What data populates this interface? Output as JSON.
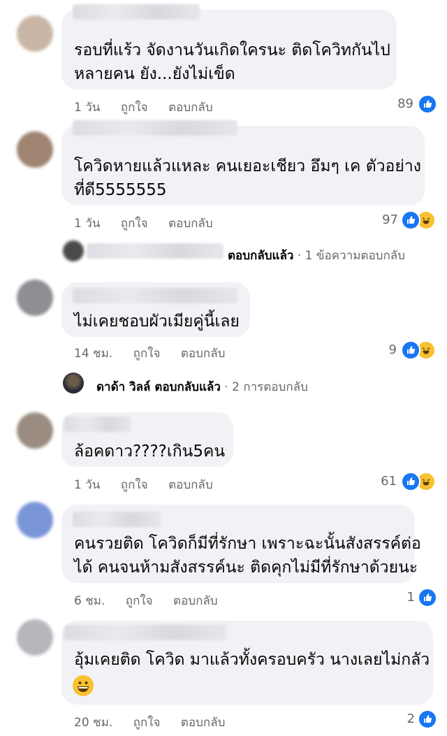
{
  "comments": [
    {
      "text_lines": [
        "รอบที่แร้ว จัดงานวันเกิดใครนะ  ติดโควิทกันไป",
        "หลายคน ยัง...ยังไม่เข็ด"
      ],
      "time": "1 วัน",
      "like": "ถูกใจ",
      "reply": "ตอบกลับ",
      "reaction_count": "89",
      "reactions": [
        "like-icon"
      ]
    },
    {
      "text_lines": [
        "โควิดหายแล้วแหละ คนเยอะเชียว อึมๆ เค ตัวอย่าง",
        "ที่ดี5555555"
      ],
      "time": "1 วัน",
      "like": "ถูกใจ",
      "reply": "ตอบกลับ",
      "reaction_count": "97",
      "reactions": [
        "like-icon",
        "haha-icon"
      ]
    },
    {
      "text_lines": [
        "ไม่เคยชอบผัวเมียคู่นี้เลย"
      ],
      "time": "14 ชม.",
      "like": "ถูกใจ",
      "reply": "ตอบกลับ",
      "reaction_count": "9",
      "reactions": [
        "like-icon",
        "haha-icon"
      ]
    },
    {
      "text_lines": [
        "ล้อคดาว????เกิน5คน"
      ],
      "time": "1 วัน",
      "like": "ถูกใจ",
      "reply": "ตอบกลับ",
      "reaction_count": "61",
      "reactions": [
        "like-icon",
        "haha-icon"
      ]
    },
    {
      "text_lines": [
        "คนรวยติด โควิดก็มีที่รักษา เพราะฉะนั้นสังสรรค์ต่อ",
        "ได้ คนจนห้ามสังสรรค์นะ ติดคุกไม่มีที่รักษาด้วยนะ"
      ],
      "time": "6 ชม.",
      "like": "ถูกใจ",
      "reply": "ตอบกลับ",
      "reaction_count": "1",
      "reactions": [
        "like-icon"
      ]
    },
    {
      "text_lines": [
        "อุ้มเคยติด โควิด มาแล้วทั้งครอบครัว  นางเลยไม่กลัว"
      ],
      "time": "20 ชม.",
      "like": "ถูกใจ",
      "reply": "ตอบกลับ",
      "reaction_count": "2",
      "reactions": [
        "like-icon"
      ],
      "emoji": "grinning-emoji"
    }
  ],
  "reply_threads": [
    {
      "name": "",
      "action": "ตอบกลับแล้ว",
      "detail": " · 1 ข้อความตอบกลับ"
    },
    {
      "name": "ดาด้า วิลล์",
      "action": " ตอบกลับแล้ว",
      "detail": " · 2 การตอบกลับ"
    }
  ],
  "colors": {
    "bubble": "#f0f2f5",
    "like": "#1877f2",
    "haha": "#f7c130",
    "meta": "#65676b"
  }
}
